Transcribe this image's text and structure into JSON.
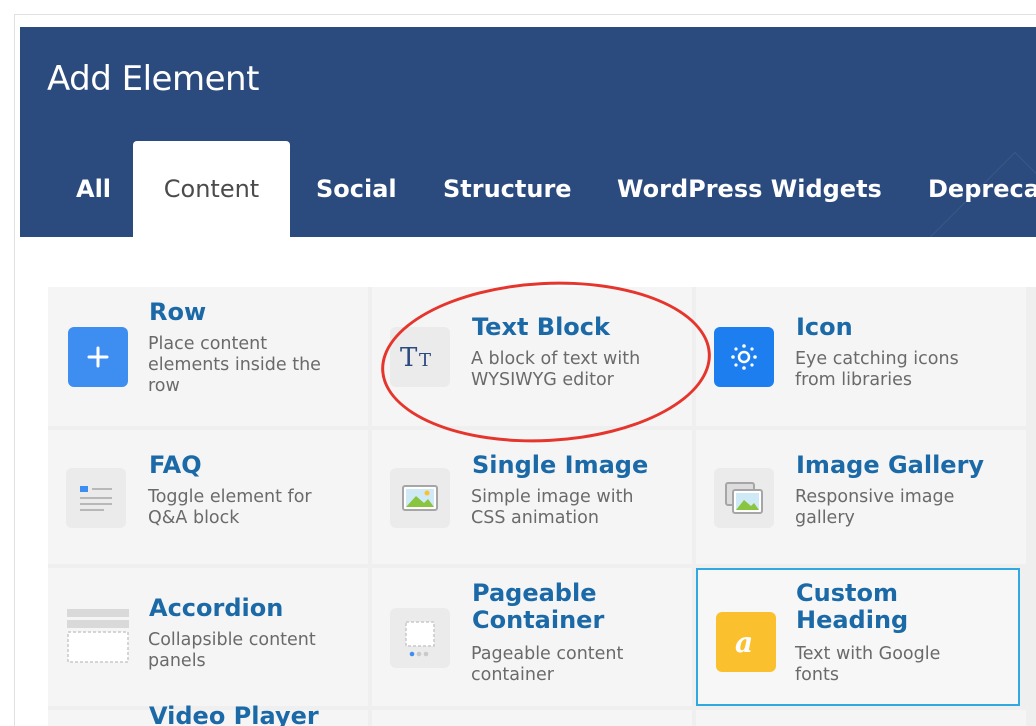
{
  "dialog": {
    "title": "Add Element",
    "tabs": [
      {
        "label": "All"
      },
      {
        "label": "Content",
        "active": true
      },
      {
        "label": "Social"
      },
      {
        "label": "Structure"
      },
      {
        "label": "WordPress Widgets"
      },
      {
        "label": "Deprecat"
      }
    ]
  },
  "elements": [
    {
      "name": "Row",
      "desc": "Place content\nelements inside the\nrow",
      "icon": "plus-icon"
    },
    {
      "name": "Text Block",
      "desc": "A block of text with\nWYSIWYG editor",
      "icon": "text-tt-icon"
    },
    {
      "name": "Icon",
      "desc": "Eye catching icons\nfrom libraries",
      "icon": "sun-icon"
    },
    {
      "name": "FAQ",
      "desc": "Toggle element for\nQ&A block",
      "icon": "faq-list-icon"
    },
    {
      "name": "Single Image",
      "desc": "Simple image with\nCSS animation",
      "icon": "image-icon"
    },
    {
      "name": "Image Gallery",
      "desc": "Responsive image\ngallery",
      "icon": "gallery-icon"
    },
    {
      "name": "Accordion",
      "desc": "Collapsible content\npanels",
      "icon": "accordion-icon"
    },
    {
      "name": "Pageable\nContainer",
      "desc": "Pageable content\ncontainer",
      "icon": "pageable-icon"
    },
    {
      "name": "Custom\nHeading",
      "desc": "Text with Google\nfonts",
      "icon": "font-a-icon"
    },
    {
      "name": "Video Player",
      "desc": "",
      "icon": ""
    }
  ],
  "colors": {
    "header": "#2b4a7d",
    "accent_blue": "#1b6aa7",
    "icon_blue": "#3d8ef0",
    "icon_yellow": "#fbc02d",
    "selected_border": "#2fa9e0",
    "annotation_red": "#e5352c"
  }
}
